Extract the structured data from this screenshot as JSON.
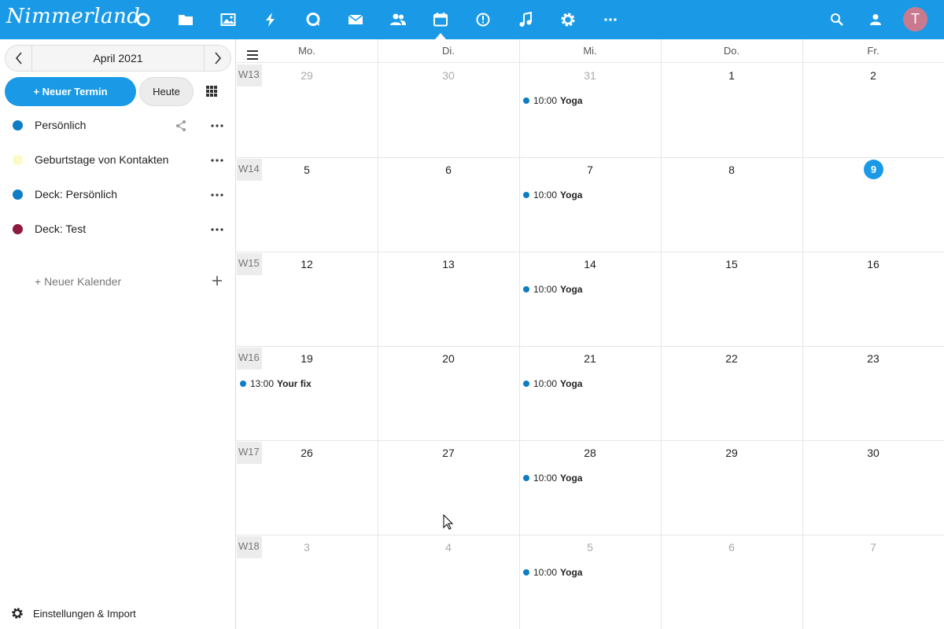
{
  "header": {
    "logo": "Nimmerland",
    "apps": [
      {
        "name": "dashboard-icon"
      },
      {
        "name": "files-icon"
      },
      {
        "name": "photos-icon"
      },
      {
        "name": "activity-icon"
      },
      {
        "name": "talk-icon"
      },
      {
        "name": "mail-icon"
      },
      {
        "name": "contacts-icon"
      },
      {
        "name": "calendar-icon"
      },
      {
        "name": "deck-icon"
      },
      {
        "name": "music-icon"
      },
      {
        "name": "settings-icon"
      },
      {
        "name": "more-apps-icon"
      }
    ],
    "active_app": "calendar-icon",
    "avatar_letter": "T",
    "avatar_color": "#c97a8e",
    "accent_color": "#1a9ae6"
  },
  "sidebar": {
    "month_label": "April 2021",
    "new_event_label": "+ Neuer Termin",
    "today_label": "Heute",
    "calendars": [
      {
        "label": "Persönlich",
        "color": "#0e7dc6",
        "shared": true
      },
      {
        "label": "Geburtstage von Kontakten",
        "color": "#fafac8",
        "shared": false
      },
      {
        "label": "Deck: Persönlich",
        "color": "#0e7dc6",
        "shared": false
      },
      {
        "label": "Deck: Test",
        "color": "#8e1a3c",
        "shared": false
      }
    ],
    "new_calendar_label": "+ Neuer Kalender",
    "settings_label": "Einstellungen & Import"
  },
  "calendar": {
    "day_headers": [
      "Mo.",
      "Di.",
      "Mi.",
      "Do.",
      "Fr."
    ],
    "weeks": [
      {
        "label": "W13",
        "days": [
          {
            "n": "29",
            "other": true
          },
          {
            "n": "30",
            "other": true
          },
          {
            "n": "31",
            "other": true
          },
          {
            "n": "1"
          },
          {
            "n": "2"
          }
        ]
      },
      {
        "label": "W14",
        "days": [
          {
            "n": "5"
          },
          {
            "n": "6"
          },
          {
            "n": "7"
          },
          {
            "n": "8"
          },
          {
            "n": "9",
            "today": true
          }
        ]
      },
      {
        "label": "W15",
        "days": [
          {
            "n": "12"
          },
          {
            "n": "13"
          },
          {
            "n": "14"
          },
          {
            "n": "15"
          },
          {
            "n": "16"
          }
        ]
      },
      {
        "label": "W16",
        "days": [
          {
            "n": "19"
          },
          {
            "n": "20"
          },
          {
            "n": "21"
          },
          {
            "n": "22"
          },
          {
            "n": "23"
          }
        ]
      },
      {
        "label": "W17",
        "days": [
          {
            "n": "26"
          },
          {
            "n": "27"
          },
          {
            "n": "28"
          },
          {
            "n": "29"
          },
          {
            "n": "30"
          }
        ]
      },
      {
        "label": "W18",
        "days": [
          {
            "n": "3",
            "other": true
          },
          {
            "n": "4",
            "other": true
          },
          {
            "n": "5",
            "other": true
          },
          {
            "n": "6",
            "other": true
          },
          {
            "n": "7",
            "other": true
          }
        ]
      }
    ],
    "events": [
      {
        "week": 0,
        "day": 2,
        "time": "10:00",
        "title": "Yoga"
      },
      {
        "week": 1,
        "day": 2,
        "time": "10:00",
        "title": "Yoga"
      },
      {
        "week": 2,
        "day": 2,
        "time": "10:00",
        "title": "Yoga"
      },
      {
        "week": 3,
        "day": 0,
        "time": "13:00",
        "title": "Your fix"
      },
      {
        "week": 3,
        "day": 2,
        "time": "10:00",
        "title": "Yoga"
      },
      {
        "week": 4,
        "day": 2,
        "time": "10:00",
        "title": "Yoga"
      },
      {
        "week": 5,
        "day": 2,
        "time": "10:00",
        "title": "Yoga"
      }
    ]
  }
}
